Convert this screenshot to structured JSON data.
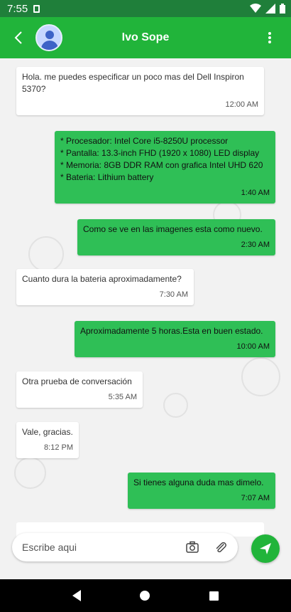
{
  "status_bar": {
    "time": "7:55"
  },
  "header": {
    "contact_name": "Ivo Sope"
  },
  "messages": [
    {
      "direction": "in",
      "text": "Hola. me puedes especificar un poco mas del Dell Inspiron 5370?",
      "time": "12:00 AM"
    },
    {
      "direction": "out",
      "lines": [
        "* Procesador: Intel Core i5-8250U processor",
        "* Pantalla: 13.3-inch FHD (1920 x 1080) LED display",
        "* Memoria: 8GB DDR RAM con grafica Intel UHD 620",
        "* Bateria: Lithium battery"
      ],
      "time": "1:40 AM"
    },
    {
      "direction": "out",
      "text": "Como se ve en las imagenes esta como nuevo.",
      "time": "2:30 AM"
    },
    {
      "direction": "in",
      "text": "Cuanto dura la bateria aproximadamente?",
      "time": "7:30 AM"
    },
    {
      "direction": "out",
      "text": "Aproximadamente 5 horas.Esta en buen estado.",
      "time": "10:00 AM"
    },
    {
      "direction": "in",
      "text": "Otra prueba de conversación",
      "time": "5:35 AM"
    },
    {
      "direction": "in",
      "text": "Vale, gracias.",
      "time": "8:12 PM"
    },
    {
      "direction": "out",
      "text": "Si tienes alguna duda mas dimelo.",
      "time": "7:07 AM"
    }
  ],
  "composer": {
    "placeholder": "Escribe aqui"
  },
  "icons": {
    "back": "arrow-left-icon",
    "avatar": "person-icon",
    "menu": "more-vert-icon",
    "camera": "camera-icon",
    "attach": "paperclip-icon",
    "send": "send-icon"
  },
  "colors": {
    "primary": "#21b43a",
    "status_bar": "#1f7f3a",
    "outgoing_bubble": "#2fbf56",
    "incoming_bubble": "#ffffff"
  }
}
